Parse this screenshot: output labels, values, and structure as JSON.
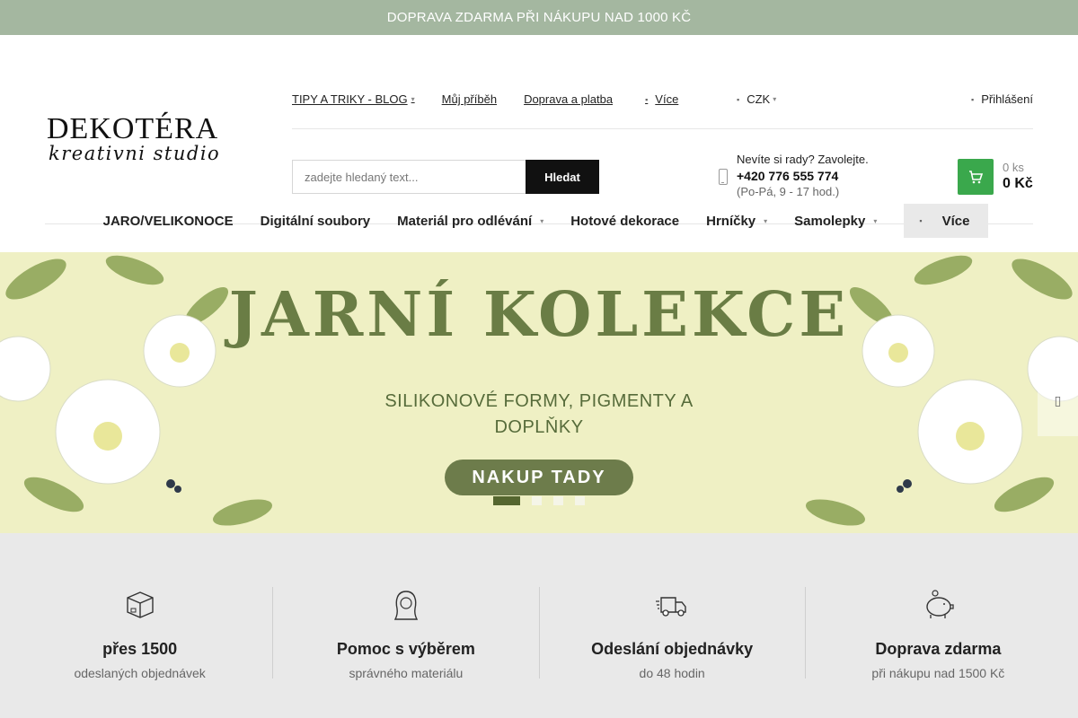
{
  "topbar": {
    "text": "DOPRAVA ZDARMA PŘI NÁKUPU NAD 1000 KČ"
  },
  "logo": {
    "brand": "DEKOTÉRA",
    "tagline": "kreativni studio"
  },
  "topnav": {
    "items": [
      {
        "label": "TIPY A TRIKY - BLOG"
      },
      {
        "label": "Můj příběh"
      },
      {
        "label": "Doprava a platba"
      }
    ],
    "more": "Více"
  },
  "currency": {
    "value": "CZK"
  },
  "login": {
    "label": "Přihlášení"
  },
  "search": {
    "placeholder": "zadejte hledaný text...",
    "button": "Hledat"
  },
  "contact": {
    "prompt": "Nevíte si rady? Zavolejte.",
    "phone": "+420 776 555 774",
    "hours": "(Po-Pá, 9 - 17 hod.)"
  },
  "cart": {
    "count": "0 ks",
    "price": "0 Kč"
  },
  "mainnav": {
    "items": [
      {
        "label": "JARO/VELIKONOCE"
      },
      {
        "label": "Digitální soubory"
      },
      {
        "label": "Materiál pro odlévání"
      },
      {
        "label": "Hotové dekorace"
      },
      {
        "label": "Hrníčky"
      },
      {
        "label": "Samolepky"
      }
    ],
    "more": "Více"
  },
  "hero": {
    "title": "JARNÍ KOLEKCE",
    "subtitle_line1": "SILIKONOVÉ FORMY, PIGMENTY A",
    "subtitle_line2": "DOPLŇKY",
    "cta": "NAKUP TADY"
  },
  "features": [
    {
      "icon": "box-icon",
      "title": "přes 1500",
      "subtitle": "odeslaných objednávek"
    },
    {
      "icon": "woman-icon",
      "title": "Pomoc s výběrem",
      "subtitle": "správného materiálu"
    },
    {
      "icon": "truck-icon",
      "title": "Odeslání objednávky",
      "subtitle": "do 48 hodin"
    },
    {
      "icon": "piggy-bank-icon",
      "title": "Doprava zdarma",
      "subtitle": "při nákupu nad 1500 Kč"
    }
  ],
  "colors": {
    "accent": "#3aa84c",
    "topbar": "#a4b7a0",
    "hero_text": "#6a7d45"
  }
}
